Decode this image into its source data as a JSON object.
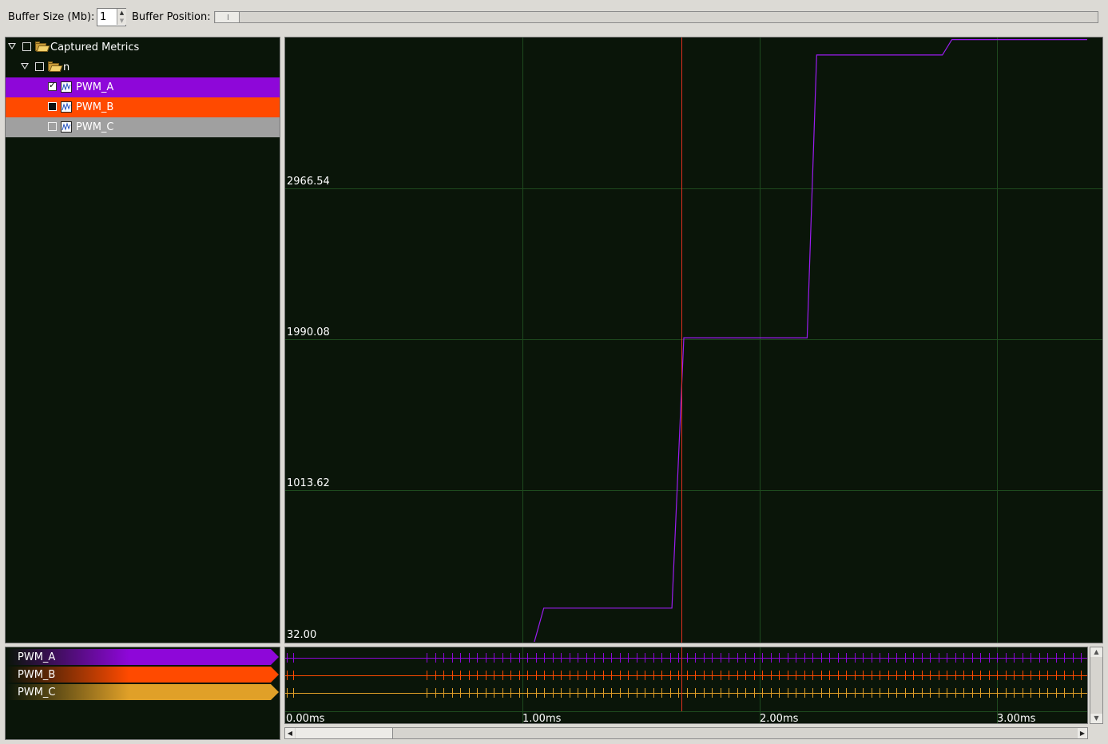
{
  "toolbar": {
    "buffer_size_label": "Buffer Size (Mb):",
    "buffer_size_value": "1",
    "buffer_position_label": "Buffer Position:"
  },
  "tree": {
    "root": {
      "label": "Captured Metrics",
      "checked": false,
      "expanded": true
    },
    "group": {
      "label": "n",
      "checked": false,
      "expanded": true
    },
    "metrics": [
      {
        "label": "PWM_A",
        "state": "checked",
        "color": "#8e07d9"
      },
      {
        "label": "PWM_B",
        "state": "filled",
        "color": "#ff4a00"
      },
      {
        "label": "PWM_C",
        "state": "unchecked",
        "color": "#a0a0a0"
      }
    ]
  },
  "graph": {
    "y_ticks": [
      "32.00",
      "1013.62",
      "1990.08",
      "2966.54"
    ],
    "cursor_color": "#e03020",
    "line_color": "#9b1cf0"
  },
  "chart_data": {
    "type": "line",
    "title": "",
    "xlabel": "",
    "ylabel": "",
    "x_unit": "ms",
    "ylim": [
      32.0,
      3920
    ],
    "xlim": [
      0,
      3.4
    ],
    "series": [
      {
        "name": "PWM_A",
        "x": [
          1.05,
          1.09,
          1.63,
          1.68,
          2.2,
          2.24,
          2.77,
          2.81,
          3.38
        ],
        "y": [
          32,
          250,
          250,
          2000,
          2000,
          3830,
          3830,
          3930,
          3930
        ]
      }
    ],
    "cursor_x": 1.67,
    "grid": true
  },
  "legend": {
    "items": [
      {
        "label": "PWM_A",
        "color": "#8e07d9"
      },
      {
        "label": "PWM_B",
        "color": "#ff4a00"
      },
      {
        "label": "PWM_C",
        "color": "#e0a028"
      }
    ]
  },
  "timeline": {
    "x_ticks": [
      "0.00ms",
      "1.00ms",
      "2.00ms",
      "3.00ms"
    ]
  }
}
